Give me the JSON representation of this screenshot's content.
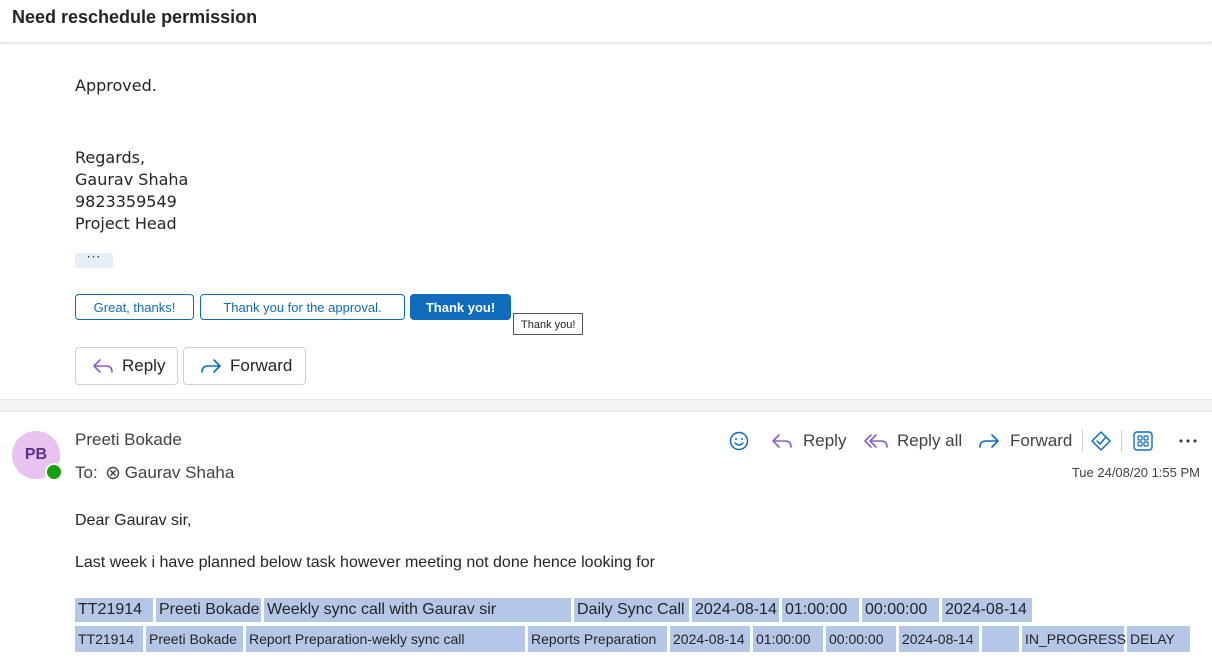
{
  "subject": "Need reschedule permission",
  "message1": {
    "body_lines": [
      "Approved."
    ],
    "signature": [
      "Regards,",
      "Gaurav Shaha",
      "9823359549",
      "Project Head"
    ],
    "ellipsis": "···",
    "suggested_replies": [
      "Great, thanks!",
      "Thank you for the approval.",
      "Thank you!"
    ],
    "tooltip": "Thank you!",
    "reply_label": "Reply",
    "forward_label": "Forward"
  },
  "message2": {
    "avatar_initials": "PB",
    "sender": "Preeti Bokade",
    "to_label": "To:",
    "recipient": "Gaurav Shaha",
    "timestamp": "Tue 24/08/20 1:55 PM",
    "toolbar": {
      "reply": "Reply",
      "reply_all": "Reply all",
      "forward": "Forward"
    },
    "greeting": "Dear Gaurav sir,",
    "intro": "Last week i have planned below task however meeting  not done hence looking for",
    "task_rows": [
      [
        "TT21914",
        "Preeti Bokade",
        "Weekly sync call with Gaurav sir",
        "Daily Sync Call",
        "2024-08-14",
        "01:00:00",
        "00:00:00",
        "2024-08-14"
      ],
      [
        "TT21914",
        "Preeti Bokade",
        "Report Preparation-wekly sync call",
        "Reports Preparation",
        "2024-08-14",
        "01:00:00",
        "00:00:00",
        "2024-08-14",
        "",
        "IN_PROGRESS",
        "DELAY"
      ]
    ]
  },
  "colors": {
    "accent": "#0f6cbd",
    "table_cell": "#b4c7e7",
    "avatar_bg": "#e8c3f0",
    "presence": "#13a10e"
  }
}
